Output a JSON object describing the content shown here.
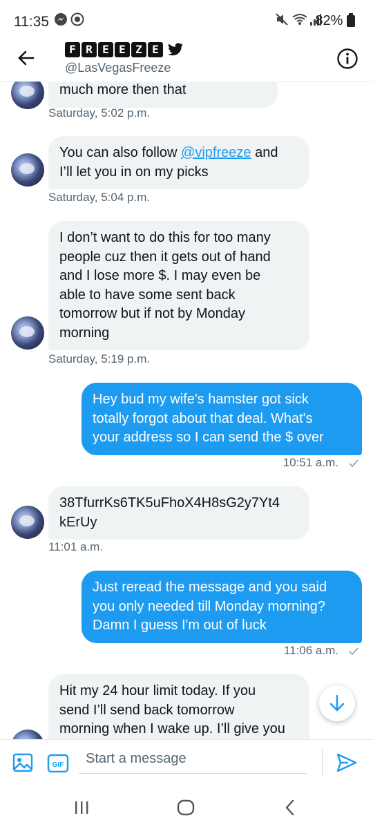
{
  "status_bar": {
    "time": "11:35",
    "battery": "82%",
    "icons": [
      "messenger-icon",
      "nfc-icon",
      "mute-icon",
      "wifi-icon",
      "signal-icon",
      "battery-icon"
    ]
  },
  "header": {
    "brand_letters": [
      "F",
      "R",
      "E",
      "E",
      "Z",
      "E"
    ],
    "handle": "@LasVegasFreeze",
    "back_icon": "back-arrow-icon",
    "info_icon": "info-icon",
    "verified_icon": "twitter-bird-icon"
  },
  "messages": [
    {
      "dir": "in",
      "text": "much more then that",
      "time": "Saturday, 5:02 p.m."
    },
    {
      "dir": "in",
      "text_before": "You can also follow ",
      "link": "@vipfreeze",
      "text_after": " and",
      "line2": "I’ll let you in on my picks",
      "time": "Saturday, 5:04 p.m."
    },
    {
      "dir": "in",
      "lines": [
        "I don’t want to do this for too many",
        "people cuz then it gets out of hand",
        "and I lose more $. I may even be",
        "able to have some sent back",
        "tomorrow but if not by Monday",
        "morning"
      ],
      "time": "Saturday, 5:19 p.m."
    },
    {
      "dir": "out",
      "lines": [
        "Hey bud my wife's hamster got sick",
        "totally forgot about that deal. What's",
        "your address so I can send the $ over"
      ],
      "time": "10:51 a.m."
    },
    {
      "dir": "in",
      "lines": [
        "38TfurrKs6TK5uFhoX4H8sG2y7Yt4",
        "kErUy"
      ],
      "time": "11:01 a.m."
    },
    {
      "dir": "out",
      "lines": [
        "Just reread the message and you said",
        "you only needed till Monday morning?",
        "Damn I guess I'm out of luck"
      ],
      "time": "11:06 a.m."
    },
    {
      "dir": "in",
      "lines": [
        "Hit my 24 hour limit today. If you",
        "send I’ll send back tomorrow",
        "morning when I wake up. I’ll give you"
      ]
    }
  ],
  "composer": {
    "placeholder": "Start a message",
    "gif_label": "GIF"
  },
  "colors": {
    "accent": "#1d9bf0",
    "incoming_bubble": "#eff3f4",
    "muted_text": "#536471"
  }
}
